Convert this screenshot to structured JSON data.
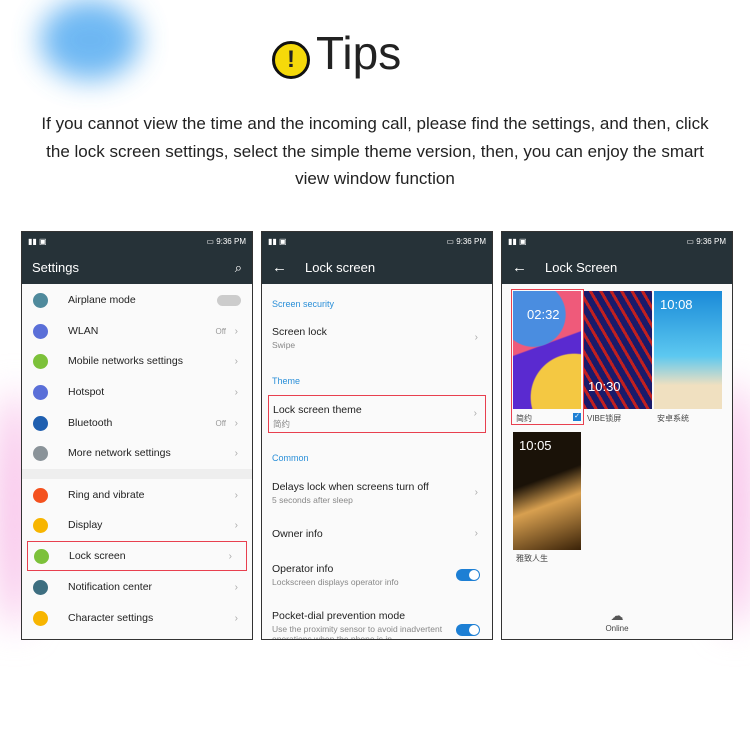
{
  "header": {
    "title": "Tips",
    "icon": "warning-icon",
    "description": "If you cannot view the time and the incoming call, please find the settings, and then, click the lock screen settings, select the simple theme version, then, you can enjoy the smart view window function"
  },
  "status": {
    "time": "9:36",
    "ampm": "PM"
  },
  "settings": {
    "title": "Settings",
    "items": [
      {
        "label": "Airplane mode",
        "color": "#4f8a9c",
        "value": ""
      },
      {
        "label": "WLAN",
        "color": "#5a6fd8",
        "value": "Off"
      },
      {
        "label": "Mobile networks settings",
        "color": "#7cc13a",
        "value": ""
      },
      {
        "label": "Hotspot",
        "color": "#5a6fd8",
        "value": ""
      },
      {
        "label": "Bluetooth",
        "color": "#1f5fb0",
        "value": "Off"
      },
      {
        "label": "More network settings",
        "color": "#8a9399",
        "value": ""
      },
      {
        "label": "Ring and vibrate",
        "color": "#f4511e",
        "value": ""
      },
      {
        "label": "Display",
        "color": "#f7b500",
        "value": ""
      },
      {
        "label": "Lock screen",
        "color": "#7cc13a",
        "value": ""
      },
      {
        "label": "Notification center",
        "color": "#3d6e80",
        "value": ""
      },
      {
        "label": "Character settings",
        "color": "#f7b500",
        "value": ""
      }
    ]
  },
  "lock": {
    "title": "Lock screen",
    "sec_security": "Screen security",
    "screen_lock": "Screen lock",
    "screen_lock_value": "Swipe",
    "sec_theme": "Theme",
    "theme": "Lock screen theme",
    "theme_value": "简约",
    "sec_common": "Common",
    "delay": "Delays lock when screens turn off",
    "delay_value": "5 seconds after sleep",
    "owner": "Owner info",
    "operator": "Operator info",
    "operator_value": "Lockscreen displays operator info",
    "pocket": "Pocket-dial prevention mode",
    "pocket_value": "Use the proximity sensor to avoid inadvertent operations when the phone is in"
  },
  "themes": {
    "title": "Lock Screen",
    "items": [
      {
        "label": "简约",
        "clock": "02:32",
        "selected": true
      },
      {
        "label": "VIBE锁屏",
        "clock": "10:30"
      },
      {
        "label": "安卓系统",
        "clock": "10:08"
      },
      {
        "label": "雅致人生",
        "clock": "10:05"
      }
    ],
    "online": "Online"
  }
}
